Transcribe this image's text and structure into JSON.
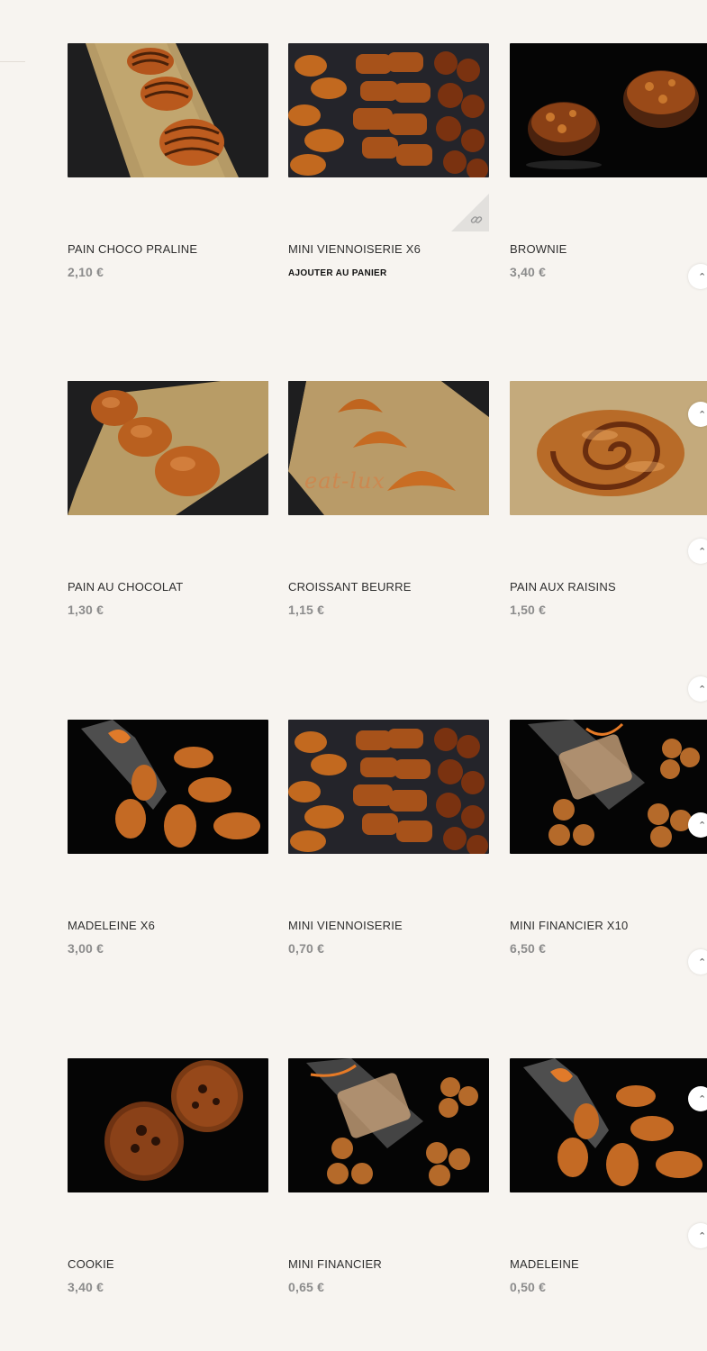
{
  "products": [
    {
      "name": "PAIN CHOCO PRALINE",
      "price": "2,10 €"
    },
    {
      "name": "MINI VIENNOISERIE X6",
      "price": "",
      "action": "AJOUTER AU PANIER"
    },
    {
      "name": "BROWNIE",
      "price": "3,40 €"
    },
    {
      "name": "PAIN AU CHOCOLAT",
      "price": "1,30 €"
    },
    {
      "name": "CROISSANT BEURRE",
      "price": "1,15 €",
      "watermark": "eat-lux"
    },
    {
      "name": "PAIN AUX RAISINS",
      "price": "1,50 €"
    },
    {
      "name": "MADELEINE X6",
      "price": "3,00 €"
    },
    {
      "name": "MINI VIENNOISERIE",
      "price": "0,70 €"
    },
    {
      "name": "MINI FINANCIER X10",
      "price": "6,50 €"
    },
    {
      "name": "COOKIE",
      "price": "3,40 €"
    },
    {
      "name": "MINI FINANCIER",
      "price": "0,65 €"
    },
    {
      "name": "MADELEINE",
      "price": "0,50 €"
    }
  ],
  "icons": {
    "link": "link-icon",
    "scroll_up": "chevron-up-icon"
  },
  "colors": {
    "background": "#f7f4f0",
    "price": "#8c8c8c",
    "name": "#2f2f2f"
  }
}
